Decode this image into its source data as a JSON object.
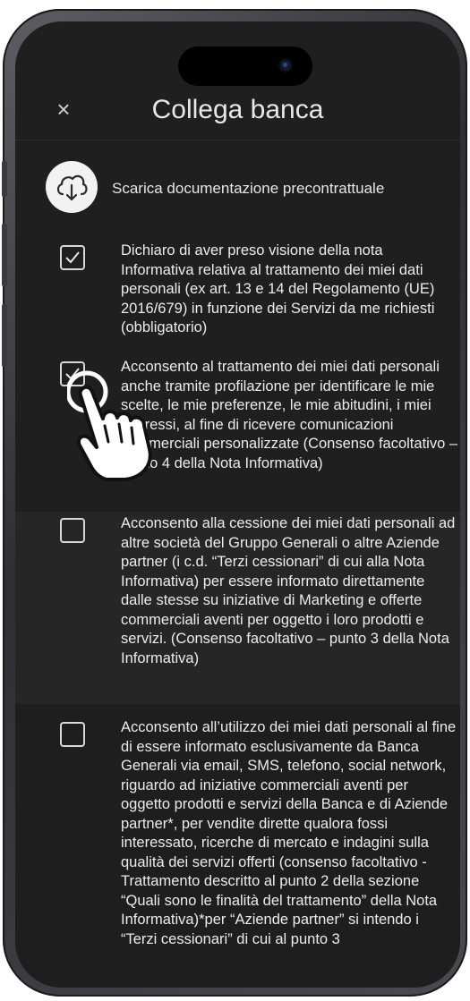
{
  "header": {
    "close_symbol": "×",
    "title": "Collega banca"
  },
  "download": {
    "icon": "cloud-download-icon",
    "label": "Scarica documentazione precontrattuale"
  },
  "consents": [
    {
      "checked": true,
      "text": "Dichiaro di aver preso visione della nota Informativa relativa al trattamento dei miei dati personali (ex art. 13 e 14 del Regolamento (UE) 2016/679) in funzione dei Servizi da me richiesti (obbligatorio)"
    },
    {
      "checked": true,
      "text": "Acconsento al trattamento dei miei dati personali anche tramite profilazione per identificare le mie scelte, le mie preferenze, le mie abitudini, i miei interessi, al fine di ricevere comunicazioni commerciali personalizzate (Consenso facoltativo – punto 4 della Nota Informativa)"
    },
    {
      "checked": false,
      "text": "Acconsento alla cessione dei miei dati personali ad altre società del Gruppo Generali o altre Aziende partner (i c.d. “Terzi cessionari” di cui alla Nota Informativa) per essere informato direttamente dalle stesse su iniziative di Marketing e offerte commerciali aventi per oggetto i loro prodotti e servizi. (Consenso facoltativo – punto 3 della Nota Informativa)"
    },
    {
      "checked": false,
      "text": "Acconsento all’utilizzo dei miei dati personali al fine di essere informato esclusivamente da Banca Generali via email, SMS, telefono, social network, riguardo ad iniziative commerciali aventi per oggetto prodotti e servizi della Banca e di Aziende partner*, per vendite dirette qualora fossi interessato, ricerche di mercato e indagini sulla qualità dei servizi offerti (consenso facoltativo - Trattamento descritto al punto 2 della sezione “Quali sono le finalità del trattamento” della Nota Informativa)*per “Aziende partner” si intendo i “Terzi cessionari” di cui al punto 3"
    }
  ],
  "colors": {
    "screen_background": "#1f1f1f",
    "text": "#ececec",
    "checkbox_border": "#d8d8d8"
  }
}
